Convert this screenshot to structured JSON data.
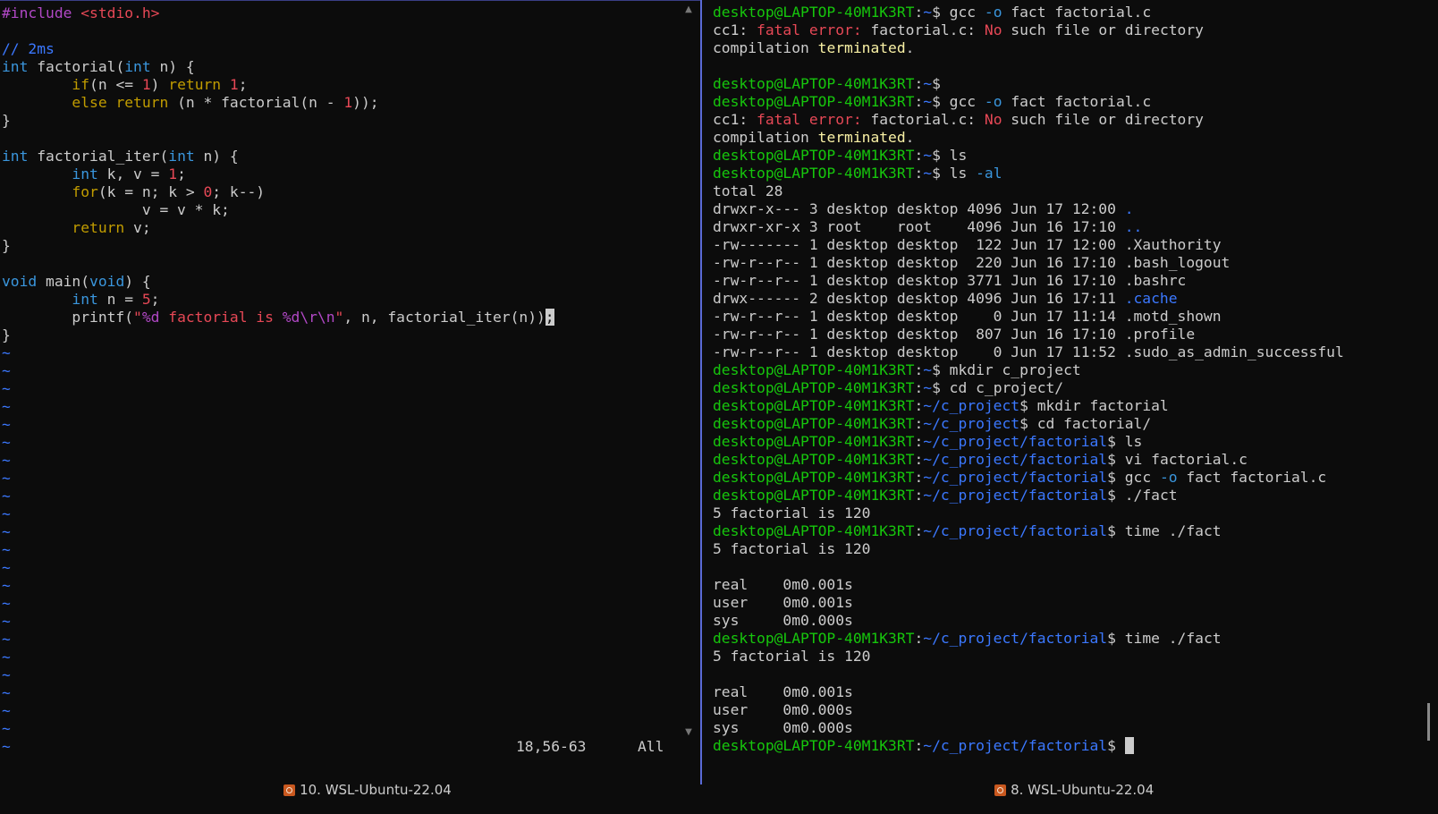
{
  "colors": {
    "background": "#0c0c0c",
    "default_text": "#cccccc",
    "vim_comment": "#3b78ff",
    "vim_type": "#3a96dd",
    "vim_keyword": "#c19c00",
    "vim_constant": "#e74856",
    "vim_preproc": "#b148c6",
    "vim_tilde": "#3b78ff",
    "prompt_user": "#16c60c",
    "prompt_path": "#3b78ff",
    "error_red": "#e74856",
    "warn_yellow": "#f9f1a5",
    "dir_blue": "#3b78ff",
    "flag_blue": "#3a96dd"
  },
  "vim": {
    "lines": [
      [
        {
          "t": "#include ",
          "c": "#b148c6"
        },
        {
          "t": "<stdio.h>",
          "c": "#e74856"
        }
      ],
      [],
      [
        {
          "t": "// 2ms",
          "c": "#3b78ff"
        }
      ],
      [
        {
          "t": "int",
          "c": "#3a96dd"
        },
        {
          "t": " factorial("
        },
        {
          "t": "int",
          "c": "#3a96dd"
        },
        {
          "t": " n) {"
        }
      ],
      [
        {
          "t": "        "
        },
        {
          "t": "if",
          "c": "#c19c00"
        },
        {
          "t": "(n <= "
        },
        {
          "t": "1",
          "c": "#e74856"
        },
        {
          "t": ") "
        },
        {
          "t": "return",
          "c": "#c19c00"
        },
        {
          "t": " "
        },
        {
          "t": "1",
          "c": "#e74856"
        },
        {
          "t": ";"
        }
      ],
      [
        {
          "t": "        "
        },
        {
          "t": "else",
          "c": "#c19c00"
        },
        {
          "t": " "
        },
        {
          "t": "return",
          "c": "#c19c00"
        },
        {
          "t": " (n * factorial(n - "
        },
        {
          "t": "1",
          "c": "#e74856"
        },
        {
          "t": "));"
        }
      ],
      [
        {
          "t": "}"
        }
      ],
      [],
      [
        {
          "t": "int",
          "c": "#3a96dd"
        },
        {
          "t": " factorial_iter("
        },
        {
          "t": "int",
          "c": "#3a96dd"
        },
        {
          "t": " n) {"
        }
      ],
      [
        {
          "t": "        "
        },
        {
          "t": "int",
          "c": "#3a96dd"
        },
        {
          "t": " k, v = "
        },
        {
          "t": "1",
          "c": "#e74856"
        },
        {
          "t": ";"
        }
      ],
      [
        {
          "t": "        "
        },
        {
          "t": "for",
          "c": "#c19c00"
        },
        {
          "t": "(k = n; k > "
        },
        {
          "t": "0",
          "c": "#e74856"
        },
        {
          "t": "; k--)"
        }
      ],
      [
        {
          "t": "                v = v * k;"
        }
      ],
      [
        {
          "t": "        "
        },
        {
          "t": "return",
          "c": "#c19c00"
        },
        {
          "t": " v;"
        }
      ],
      [
        {
          "t": "}"
        }
      ],
      [],
      [
        {
          "t": "void",
          "c": "#3a96dd"
        },
        {
          "t": " main("
        },
        {
          "t": "void",
          "c": "#3a96dd"
        },
        {
          "t": ") {"
        }
      ],
      [
        {
          "t": "        "
        },
        {
          "t": "int",
          "c": "#3a96dd"
        },
        {
          "t": " n = "
        },
        {
          "t": "5",
          "c": "#e74856"
        },
        {
          "t": ";"
        }
      ],
      [
        {
          "t": "        printf("
        },
        {
          "t": "\"%d factorial is %d\\r\\n\"",
          "c": "#e74856",
          "mixed": [
            {
              "t": "\"",
              "c": "#e74856"
            },
            {
              "t": "%d",
              "c": "#b148c6"
            },
            {
              "t": " factorial is ",
              "c": "#e74856"
            },
            {
              "t": "%d",
              "c": "#b148c6"
            },
            {
              "t": "\\r\\n",
              "c": "#b148c6"
            },
            {
              "t": "\"",
              "c": "#e74856"
            }
          ]
        },
        {
          "t": ", n, factorial_iter(n))"
        },
        {
          "t": ";",
          "cursor": true
        }
      ],
      [
        {
          "t": "}"
        }
      ],
      [
        {
          "t": "~",
          "c": "#3b78ff"
        }
      ],
      [
        {
          "t": "~",
          "c": "#3b78ff"
        }
      ],
      [
        {
          "t": "~",
          "c": "#3b78ff"
        }
      ],
      [
        {
          "t": "~",
          "c": "#3b78ff"
        }
      ],
      [
        {
          "t": "~",
          "c": "#3b78ff"
        }
      ],
      [
        {
          "t": "~",
          "c": "#3b78ff"
        }
      ],
      [
        {
          "t": "~",
          "c": "#3b78ff"
        }
      ],
      [
        {
          "t": "~",
          "c": "#3b78ff"
        }
      ],
      [
        {
          "t": "~",
          "c": "#3b78ff"
        }
      ],
      [
        {
          "t": "~",
          "c": "#3b78ff"
        }
      ],
      [
        {
          "t": "~",
          "c": "#3b78ff"
        }
      ],
      [
        {
          "t": "~",
          "c": "#3b78ff"
        }
      ],
      [
        {
          "t": "~",
          "c": "#3b78ff"
        }
      ],
      [
        {
          "t": "~",
          "c": "#3b78ff"
        }
      ],
      [
        {
          "t": "~",
          "c": "#3b78ff"
        }
      ],
      [
        {
          "t": "~",
          "c": "#3b78ff"
        }
      ],
      [
        {
          "t": "~",
          "c": "#3b78ff"
        }
      ],
      [
        {
          "t": "~",
          "c": "#3b78ff"
        }
      ],
      [
        {
          "t": "~",
          "c": "#3b78ff"
        }
      ],
      [
        {
          "t": "~",
          "c": "#3b78ff"
        }
      ],
      [
        {
          "t": "~",
          "c": "#3b78ff"
        }
      ],
      [
        {
          "t": "~",
          "c": "#3b78ff"
        }
      ],
      [
        {
          "t": "~",
          "c": "#3b78ff"
        }
      ]
    ],
    "ruler_position": "18,56-63",
    "ruler_scroll": "All"
  },
  "terminal": {
    "lines": [
      [
        {
          "t": "desktop@LAPTOP-40M1K3RT",
          "c": "#16c60c"
        },
        {
          "t": ":"
        },
        {
          "t": "~",
          "c": "#3b78ff"
        },
        {
          "t": "$ gcc "
        },
        {
          "t": "-o",
          "c": "#3a96dd"
        },
        {
          "t": " fact factorial.c"
        }
      ],
      [
        {
          "t": "cc1: "
        },
        {
          "t": "fatal error: ",
          "c": "#e74856"
        },
        {
          "t": "factorial.c: "
        },
        {
          "t": "No",
          "c": "#e74856"
        },
        {
          "t": " such file or directory"
        }
      ],
      [
        {
          "t": "compilation "
        },
        {
          "t": "terminated",
          "c": "#f9f1a5"
        },
        {
          "t": "."
        }
      ],
      [],
      [
        {
          "t": "desktop@LAPTOP-40M1K3RT",
          "c": "#16c60c"
        },
        {
          "t": ":"
        },
        {
          "t": "~",
          "c": "#3b78ff"
        },
        {
          "t": "$"
        }
      ],
      [
        {
          "t": "desktop@LAPTOP-40M1K3RT",
          "c": "#16c60c"
        },
        {
          "t": ":"
        },
        {
          "t": "~",
          "c": "#3b78ff"
        },
        {
          "t": "$ gcc "
        },
        {
          "t": "-o",
          "c": "#3a96dd"
        },
        {
          "t": " fact factorial.c"
        }
      ],
      [
        {
          "t": "cc1: "
        },
        {
          "t": "fatal error: ",
          "c": "#e74856"
        },
        {
          "t": "factorial.c: "
        },
        {
          "t": "No",
          "c": "#e74856"
        },
        {
          "t": " such file or directory"
        }
      ],
      [
        {
          "t": "compilation "
        },
        {
          "t": "terminated",
          "c": "#f9f1a5"
        },
        {
          "t": "."
        }
      ],
      [
        {
          "t": "desktop@LAPTOP-40M1K3RT",
          "c": "#16c60c"
        },
        {
          "t": ":"
        },
        {
          "t": "~",
          "c": "#3b78ff"
        },
        {
          "t": "$ ls"
        }
      ],
      [
        {
          "t": "desktop@LAPTOP-40M1K3RT",
          "c": "#16c60c"
        },
        {
          "t": ":"
        },
        {
          "t": "~",
          "c": "#3b78ff"
        },
        {
          "t": "$ ls "
        },
        {
          "t": "-al",
          "c": "#3a96dd"
        }
      ],
      [
        {
          "t": "total 28"
        }
      ],
      [
        {
          "t": "drwxr-x--- 3 desktop desktop 4096 Jun 17 12:00 "
        },
        {
          "t": ".",
          "c": "#3b78ff"
        }
      ],
      [
        {
          "t": "drwxr-xr-x 3 root    root    4096 Jun 16 17:10 "
        },
        {
          "t": "..",
          "c": "#3b78ff"
        }
      ],
      [
        {
          "t": "-rw------- 1 desktop desktop  122 Jun 17 12:00 .Xauthority"
        }
      ],
      [
        {
          "t": "-rw-r--r-- 1 desktop desktop  220 Jun 16 17:10 .bash_logout"
        }
      ],
      [
        {
          "t": "-rw-r--r-- 1 desktop desktop 3771 Jun 16 17:10 .bashrc"
        }
      ],
      [
        {
          "t": "drwx------ 2 desktop desktop 4096 Jun 16 17:11 "
        },
        {
          "t": ".cache",
          "c": "#3b78ff"
        }
      ],
      [
        {
          "t": "-rw-r--r-- 1 desktop desktop    0 Jun 17 11:14 .motd_shown"
        }
      ],
      [
        {
          "t": "-rw-r--r-- 1 desktop desktop  807 Jun 16 17:10 .profile"
        }
      ],
      [
        {
          "t": "-rw-r--r-- 1 desktop desktop    0 Jun 17 11:52 .sudo_as_admin_successful"
        }
      ],
      [
        {
          "t": "desktop@LAPTOP-40M1K3RT",
          "c": "#16c60c"
        },
        {
          "t": ":"
        },
        {
          "t": "~",
          "c": "#3b78ff"
        },
        {
          "t": "$ mkdir c_project"
        }
      ],
      [
        {
          "t": "desktop@LAPTOP-40M1K3RT",
          "c": "#16c60c"
        },
        {
          "t": ":"
        },
        {
          "t": "~",
          "c": "#3b78ff"
        },
        {
          "t": "$ cd c_project/"
        }
      ],
      [
        {
          "t": "desktop@LAPTOP-40M1K3RT",
          "c": "#16c60c"
        },
        {
          "t": ":"
        },
        {
          "t": "~/c_project",
          "c": "#3b78ff"
        },
        {
          "t": "$ mkdir factorial"
        }
      ],
      [
        {
          "t": "desktop@LAPTOP-40M1K3RT",
          "c": "#16c60c"
        },
        {
          "t": ":"
        },
        {
          "t": "~/c_project",
          "c": "#3b78ff"
        },
        {
          "t": "$ cd factorial/"
        }
      ],
      [
        {
          "t": "desktop@LAPTOP-40M1K3RT",
          "c": "#16c60c"
        },
        {
          "t": ":"
        },
        {
          "t": "~/c_project/factorial",
          "c": "#3b78ff"
        },
        {
          "t": "$ ls"
        }
      ],
      [
        {
          "t": "desktop@LAPTOP-40M1K3RT",
          "c": "#16c60c"
        },
        {
          "t": ":"
        },
        {
          "t": "~/c_project/factorial",
          "c": "#3b78ff"
        },
        {
          "t": "$ vi factorial.c"
        }
      ],
      [
        {
          "t": "desktop@LAPTOP-40M1K3RT",
          "c": "#16c60c"
        },
        {
          "t": ":"
        },
        {
          "t": "~/c_project/factorial",
          "c": "#3b78ff"
        },
        {
          "t": "$ gcc "
        },
        {
          "t": "-o",
          "c": "#3a96dd"
        },
        {
          "t": " fact factorial.c"
        }
      ],
      [
        {
          "t": "desktop@LAPTOP-40M1K3RT",
          "c": "#16c60c"
        },
        {
          "t": ":"
        },
        {
          "t": "~/c_project/factorial",
          "c": "#3b78ff"
        },
        {
          "t": "$ ./fact"
        }
      ],
      [
        {
          "t": "5 factorial is 120"
        }
      ],
      [
        {
          "t": "desktop@LAPTOP-40M1K3RT",
          "c": "#16c60c"
        },
        {
          "t": ":"
        },
        {
          "t": "~/c_project/factorial",
          "c": "#3b78ff"
        },
        {
          "t": "$ time ./fact"
        }
      ],
      [
        {
          "t": "5 factorial is 120"
        }
      ],
      [],
      [
        {
          "t": "real    0m0.001s"
        }
      ],
      [
        {
          "t": "user    0m0.001s"
        }
      ],
      [
        {
          "t": "sys     0m0.000s"
        }
      ],
      [
        {
          "t": "desktop@LAPTOP-40M1K3RT",
          "c": "#16c60c"
        },
        {
          "t": ":"
        },
        {
          "t": "~/c_project/factorial",
          "c": "#3b78ff"
        },
        {
          "t": "$ time ./fact"
        }
      ],
      [
        {
          "t": "5 factorial is 120"
        }
      ],
      [],
      [
        {
          "t": "real    0m0.001s"
        }
      ],
      [
        {
          "t": "user    0m0.000s"
        }
      ],
      [
        {
          "t": "sys     0m0.000s"
        }
      ],
      [
        {
          "t": "desktop@LAPTOP-40M1K3RT",
          "c": "#16c60c"
        },
        {
          "t": ":"
        },
        {
          "t": "~/c_project/factorial",
          "c": "#3b78ff"
        },
        {
          "t": "$ "
        },
        {
          "t": " ",
          "cursor": true
        }
      ]
    ]
  },
  "tabs": {
    "left_label": "10. WSL-Ubuntu-22.04",
    "right_label": "8. WSL-Ubuntu-22.04",
    "icon": "ubuntu-icon"
  }
}
